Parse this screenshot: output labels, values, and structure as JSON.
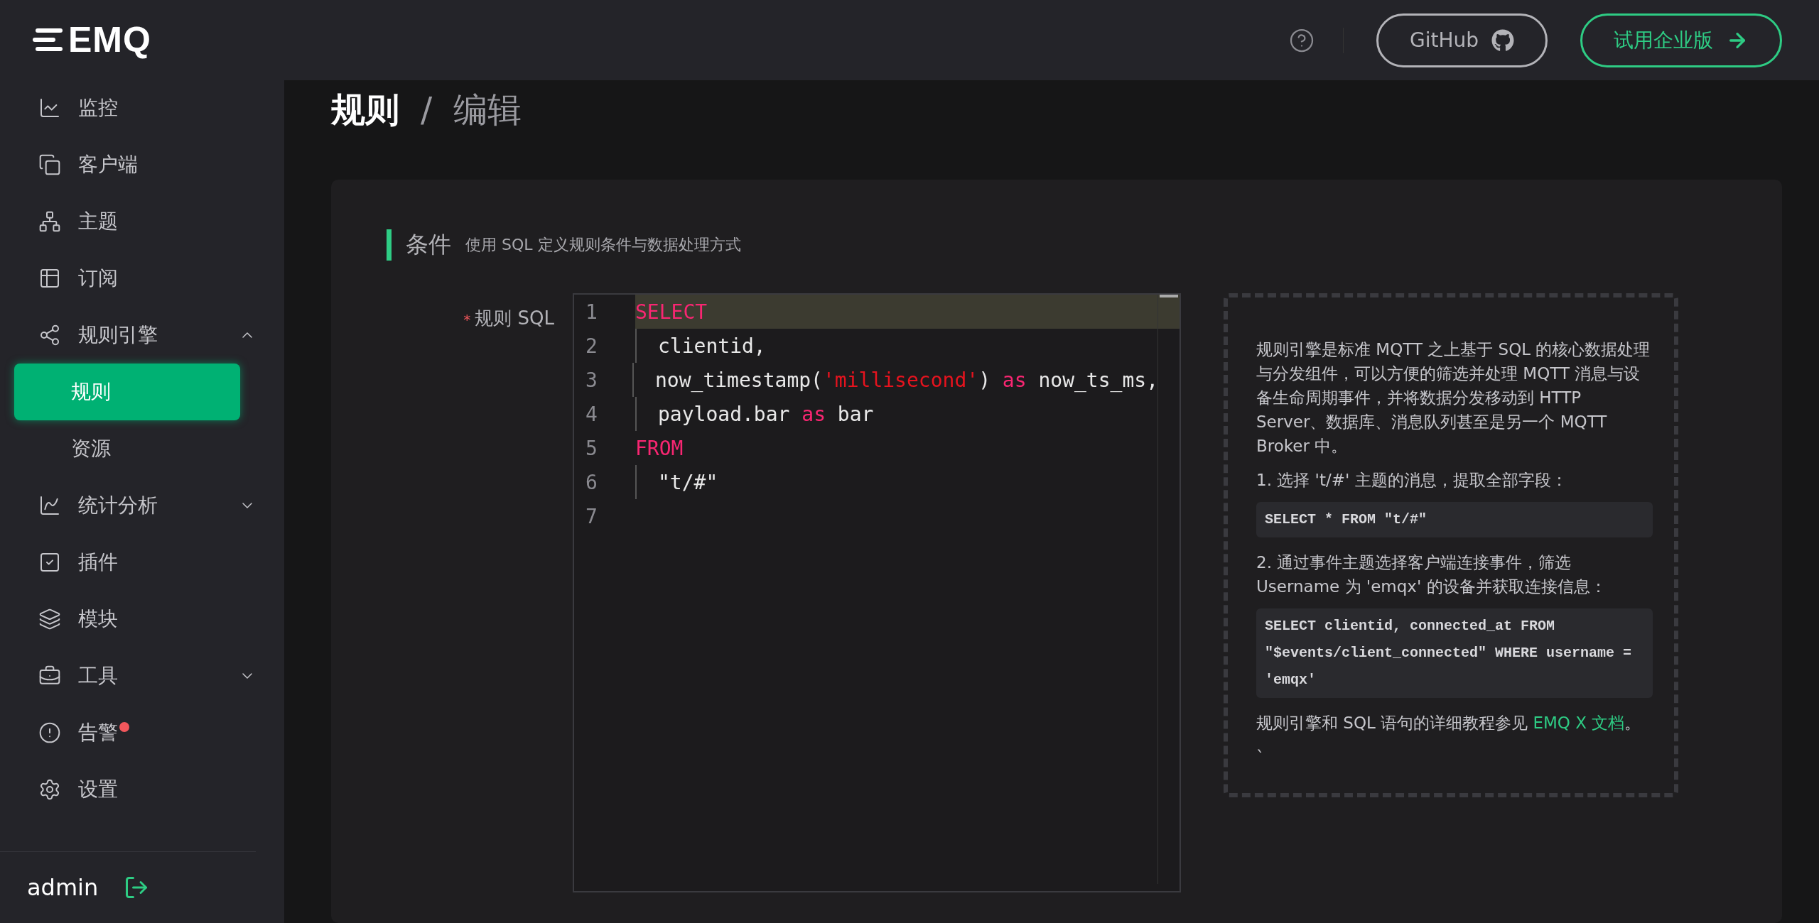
{
  "logo": "EMQ",
  "header": {
    "github": "GitHub",
    "enterprise": "试用企业版"
  },
  "sidebar": {
    "items": [
      {
        "label": "监控"
      },
      {
        "label": "客户端"
      },
      {
        "label": "主题"
      },
      {
        "label": "订阅"
      },
      {
        "label": "规则引擎",
        "expanded": true,
        "children": [
          {
            "label": "规则",
            "selected": true
          },
          {
            "label": "资源",
            "selected": false
          }
        ]
      },
      {
        "label": "统计分析",
        "expanded": false
      },
      {
        "label": "插件"
      },
      {
        "label": "模块"
      },
      {
        "label": "工具",
        "expanded": false
      },
      {
        "label": "告警",
        "alert": true
      },
      {
        "label": "设置"
      }
    ],
    "user": "admin"
  },
  "breadcrumb": [
    "规则",
    "/",
    "编辑"
  ],
  "section": {
    "title": "条件",
    "subtitle": "使用 SQL 定义规则条件与数据处理方式"
  },
  "field": {
    "label": "规则 SQL",
    "required": true,
    "required_mark": "*"
  },
  "editor": {
    "lines": [
      {
        "number": "1",
        "active": true,
        "indented": false,
        "tokens": [
          {
            "kind": "keyword",
            "text": "SELECT"
          }
        ]
      },
      {
        "number": "2",
        "active": false,
        "indented": true,
        "tokens": [
          {
            "kind": "plain",
            "text": "clientid,"
          }
        ]
      },
      {
        "number": "3",
        "active": false,
        "indented": true,
        "tokens": [
          {
            "kind": "plain",
            "text": "now_timestamp("
          },
          {
            "kind": "string",
            "text": "'millisecond'"
          },
          {
            "kind": "plain",
            "text": ") "
          },
          {
            "kind": "keyword",
            "text": "as"
          },
          {
            "kind": "plain",
            "text": " now_ts_ms,"
          }
        ]
      },
      {
        "number": "4",
        "active": false,
        "indented": true,
        "tokens": [
          {
            "kind": "plain",
            "text": "payload.bar "
          },
          {
            "kind": "keyword",
            "text": "as"
          },
          {
            "kind": "plain",
            "text": " bar"
          }
        ]
      },
      {
        "number": "5",
        "active": false,
        "indented": false,
        "tokens": [
          {
            "kind": "keyword",
            "text": "FROM"
          }
        ]
      },
      {
        "number": "6",
        "active": false,
        "indented": true,
        "tokens": [
          {
            "kind": "plain",
            "text": "\"t/#\""
          }
        ]
      },
      {
        "number": "7",
        "active": false,
        "indented": false
      }
    ]
  },
  "help": {
    "intro": "规则引擎是标准 MQTT 之上基于 SQL 的核心数据处理与分发组件，可以方便的筛选并处理 MQTT 消息与设备生命周期事件，并将数据分发移动到 HTTP Server、数据库、消息队列甚至是另一个 MQTT Broker 中。",
    "examples": [
      {
        "text": "1. 选择 't/#' 主题的消息，提取全部字段：",
        "code": "SELECT * FROM \"t/#\""
      },
      {
        "text": "2. 通过事件主题选择客户端连接事件，筛选 Username 为 'emqx' 的设备并获取连接信息：",
        "code": "SELECT clientid, connected_at FROM \"$events/client_connected\" WHERE username = 'emqx'"
      }
    ],
    "footer": "规则引擎和 SQL 语句的详细教程参见 ",
    "link": "EMQ X 文档",
    "footer_end": "。",
    "trailing": "`"
  }
}
